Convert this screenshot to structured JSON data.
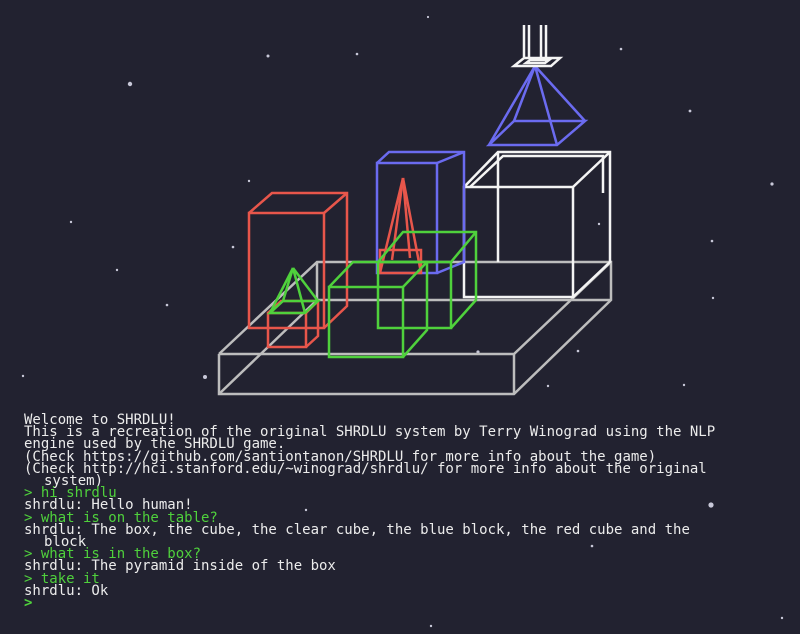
{
  "colors": {
    "background": "#222230",
    "text": "#ececec",
    "player_text": "#4fd13c",
    "table": "#bdbdbd",
    "white_objects": "#f4f4f4",
    "blue_objects": "#6b6bf0",
    "red_objects": "#e8564b",
    "green_objects": "#4fd13c"
  },
  "console": {
    "intro": [
      "Welcome to SHRDLU!",
      "This is a recreation of the original SHRDLU system by Terry Winograd using the NLP",
      "engine used by the SHRDLU game.",
      "(Check https://github.com/santiontanon/SHRDLU for more info about the game)",
      "(Check http://hci.stanford.edu/~winograd/shrdlu/ for more info about the original",
      "system)"
    ],
    "dialogue": [
      {
        "speaker": "player",
        "text": "> hi shrdlu"
      },
      {
        "speaker": "shrdlu",
        "text": "shrdlu: Hello human!"
      },
      {
        "speaker": "player",
        "text": "> what is on the table?"
      },
      {
        "speaker": "shrdlu",
        "text": "shrdlu: The box, the cube, the clear cube, the blue block, the red cube and the"
      },
      {
        "speaker": "shrdlu",
        "text": "block",
        "continuation": true
      },
      {
        "speaker": "player",
        "text": "> what is in the box?"
      },
      {
        "speaker": "shrdlu",
        "text": "shrdlu: The pyramid inside of the box"
      },
      {
        "speaker": "player",
        "text": "> take it"
      },
      {
        "speaker": "shrdlu",
        "text": "shrdlu: Ok"
      }
    ],
    "prompt": ">"
  }
}
